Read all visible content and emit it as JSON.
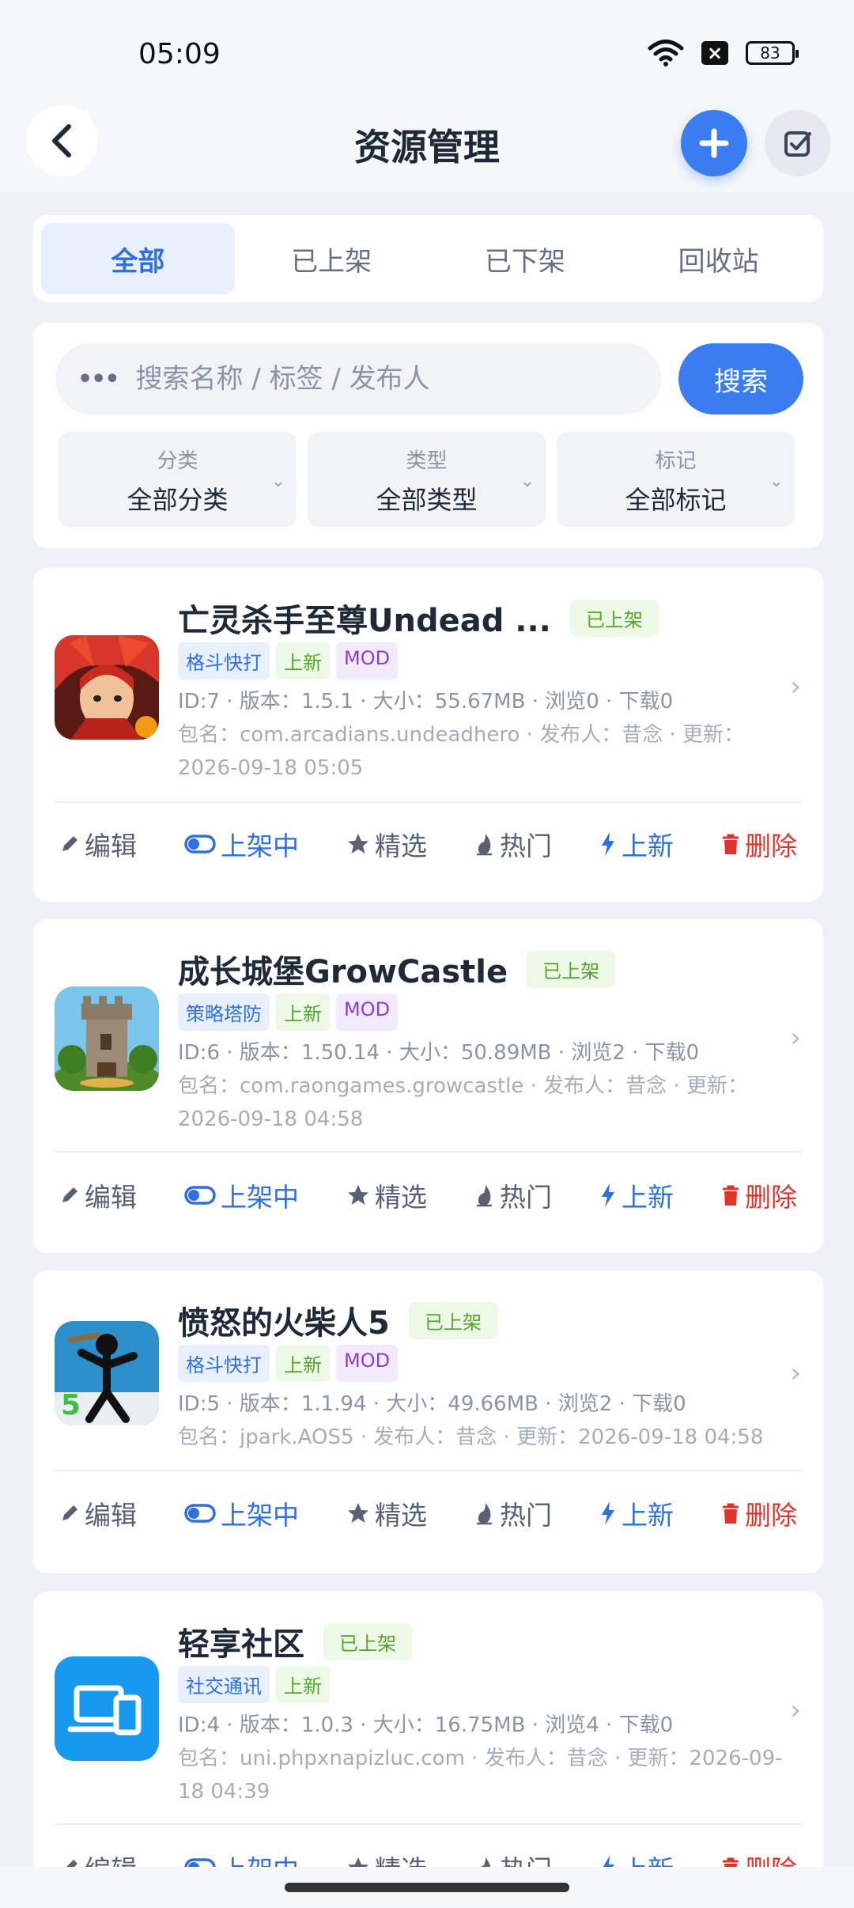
{
  "status_bar": {
    "time": "05:09",
    "battery": "83",
    "wifi_icon": "wifi-icon",
    "x_icon": "close-box-icon"
  },
  "header": {
    "title": "资源管理",
    "back_icon": "chevron-left-icon",
    "add_icon": "plus-icon",
    "check_icon": "checkbox-icon"
  },
  "tabs": [
    {
      "label": "全部",
      "active": true
    },
    {
      "label": "已上架",
      "active": false
    },
    {
      "label": "已下架",
      "active": false
    },
    {
      "label": "回收站",
      "active": false
    }
  ],
  "search": {
    "placeholder": "搜索名称 / 标签 / 发布人",
    "value": "",
    "button": "搜索"
  },
  "filters": [
    {
      "label": "分类",
      "value": "全部分类"
    },
    {
      "label": "类型",
      "value": "全部类型"
    },
    {
      "label": "标记",
      "value": "全部标记"
    }
  ],
  "actions": {
    "edit": "编辑",
    "listed": "上架中",
    "featured": "精选",
    "hot": "热门",
    "new": "上新",
    "delete": "删除"
  },
  "items": [
    {
      "name": "亡灵杀手至尊Undead ...",
      "status": "已上架",
      "tags": [
        {
          "text": "格斗快打",
          "color": "#2f6fe4"
        },
        {
          "text": "上新",
          "color": "#52a82a"
        },
        {
          "text": "MOD",
          "color": "#8a3fd1"
        }
      ],
      "meta1": "ID:7 · 版本：1.5.1 · 大小：55.67MB · 浏览0 · 下载0",
      "meta2": "包名：com.arcadians.undeadhero · 发布人：昔念 · 更新：2026-09-18 05:05"
    },
    {
      "name": "成长城堡GrowCastle",
      "status": "已上架",
      "tags": [
        {
          "text": "策略塔防",
          "color": "#2f6fe4"
        },
        {
          "text": "上新",
          "color": "#52a82a"
        },
        {
          "text": "MOD",
          "color": "#8a3fd1"
        }
      ],
      "meta1": "ID:6 · 版本：1.50.14 · 大小：50.89MB · 浏览2 · 下载0",
      "meta2": "包名：com.raongames.growcastle · 发布人：昔念 · 更新：2026-09-18 04:58"
    },
    {
      "name": "愤怒的火柴人5",
      "status": "已上架",
      "tags": [
        {
          "text": "格斗快打",
          "color": "#2f6fe4"
        },
        {
          "text": "上新",
          "color": "#52a82a"
        },
        {
          "text": "MOD",
          "color": "#8a3fd1"
        }
      ],
      "meta1": "ID:5 · 版本：1.1.94 · 大小：49.66MB · 浏览2 · 下载0",
      "meta2": "包名：jpark.AOS5 · 发布人：昔念 · 更新：2026-09-18 04:58"
    },
    {
      "name": "轻享社区",
      "status": "已上架",
      "tags": [
        {
          "text": "社交通讯",
          "color": "#2f6fe4"
        },
        {
          "text": "上新",
          "color": "#52a82a"
        }
      ],
      "meta1": "ID:4 · 版本：1.0.3 · 大小：16.75MB · 浏览4 · 下载0",
      "meta2": "包名：uni.phpxnapizluc.com · 发布人：昔念 · 更新：2026-09-18 04:39"
    }
  ]
}
